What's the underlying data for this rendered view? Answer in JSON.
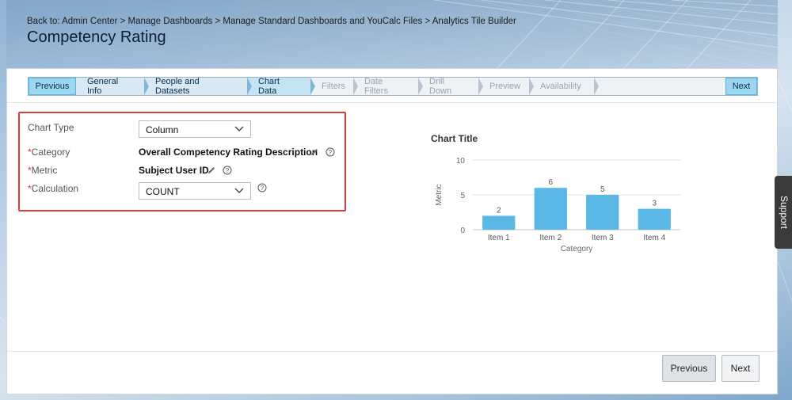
{
  "header": {
    "breadcrumb": "Back to: Admin Center > Manage Dashboards > Manage Standard Dashboards and YouCalc Files > Analytics Tile Builder",
    "title": "Competency Rating"
  },
  "wizard": {
    "previous_label": "Previous",
    "next_label": "Next",
    "steps": [
      {
        "label": "General Info",
        "state": "done"
      },
      {
        "label": "People and Datasets",
        "state": "done"
      },
      {
        "label": "Chart Data",
        "state": "current"
      },
      {
        "label": "Filters",
        "state": "todo"
      },
      {
        "label": "Date Filters",
        "state": "todo"
      },
      {
        "label": "Drill Down",
        "state": "todo"
      },
      {
        "label": "Preview",
        "state": "todo"
      },
      {
        "label": "Availability",
        "state": "todo"
      }
    ]
  },
  "form": {
    "chart_type_label": "Chart Type",
    "chart_type_value": "Column",
    "category_label": "Category",
    "category_value": "Overall Competency Rating Description",
    "metric_label": "Metric",
    "metric_value": "Subject User ID",
    "calculation_label": "Calculation",
    "calculation_value": "COUNT",
    "required_mark": "*"
  },
  "chart_data": {
    "type": "bar",
    "title": "Chart Title",
    "xlabel": "Category",
    "ylabel": "Metric",
    "categories": [
      "Item 1",
      "Item 2",
      "Item 3",
      "Item 4"
    ],
    "values": [
      2,
      6,
      5,
      3
    ],
    "ylim": [
      0,
      10
    ],
    "yticks": [
      0,
      5,
      10
    ],
    "grid": true,
    "color": "#5ab7e6"
  },
  "footer": {
    "previous_label": "Previous",
    "next_label": "Next"
  },
  "support_label": "Support"
}
